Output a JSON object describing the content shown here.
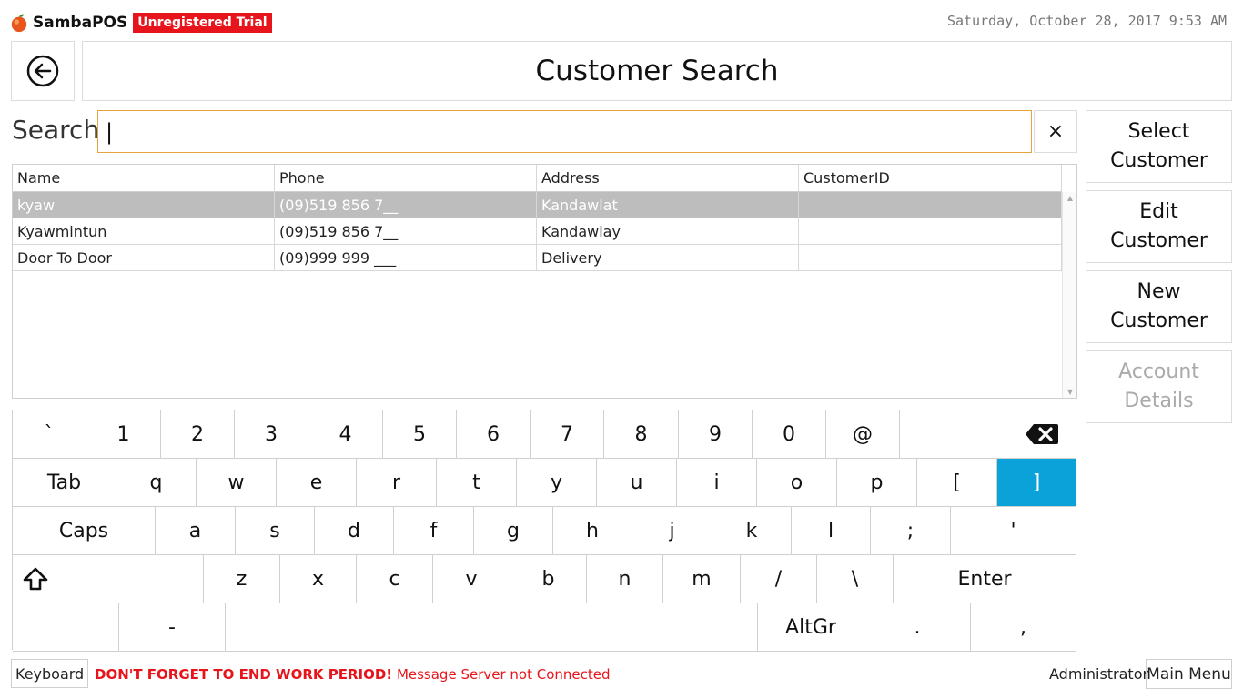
{
  "brand": {
    "name": "SambaPOS",
    "trial_badge": "Unregistered Trial",
    "logo_icon": "apple-logo-icon",
    "accent": "#e8141c"
  },
  "datetime": "Saturday, October 28, 2017 9:53 AM",
  "header": {
    "back_icon": "back-arrow-icon",
    "title": "Customer Search"
  },
  "search": {
    "label": "Search",
    "value": "|",
    "clear_label": "×"
  },
  "table": {
    "columns": [
      "Name",
      "Phone",
      "Address",
      "CustomerID"
    ],
    "rows": [
      {
        "name": "kyaw",
        "phone": "(09)519 856 7__",
        "address": "Kandawlat",
        "customer_id": "",
        "selected": true
      },
      {
        "name": "Kyawmintun",
        "phone": "(09)519 856 7__",
        "address": "Kandawlay",
        "customer_id": "",
        "selected": false
      },
      {
        "name": "Door To Door",
        "phone": "(09)999 999 ___",
        "address": "Delivery",
        "customer_id": "",
        "selected": false
      }
    ]
  },
  "actions": {
    "select_customer": "Select\nCustomer",
    "edit_customer": "Edit\nCustomer",
    "new_customer": "New\nCustomer",
    "account_details": "Account\nDetails"
  },
  "keyboard": {
    "row1": [
      "`",
      "1",
      "2",
      "3",
      "4",
      "5",
      "6",
      "7",
      "8",
      "9",
      "0",
      "@",
      "backspace-icon"
    ],
    "row2": [
      "Tab",
      "q",
      "w",
      "e",
      "r",
      "t",
      "y",
      "u",
      "i",
      "o",
      "p",
      "[",
      "]"
    ],
    "row3": [
      "Caps",
      "a",
      "s",
      "d",
      "f",
      "g",
      "h",
      "j",
      "k",
      "l",
      ";",
      "'"
    ],
    "row4": [
      "shift-icon",
      "z",
      "x",
      "c",
      "v",
      "b",
      "n",
      "m",
      "/",
      "\\",
      "Enter"
    ],
    "row5": [
      "",
      "-",
      "",
      "AltGr",
      ".",
      ","
    ],
    "active_key": "]",
    "active_color": "#0aa2d8"
  },
  "footer": {
    "keyboard_toggle": "Keyboard",
    "warning": "DON'T FORGET TO END WORK PERIOD!",
    "status": "Message Server not Connected",
    "user": "Administrator",
    "main_menu": "Main Menu"
  }
}
